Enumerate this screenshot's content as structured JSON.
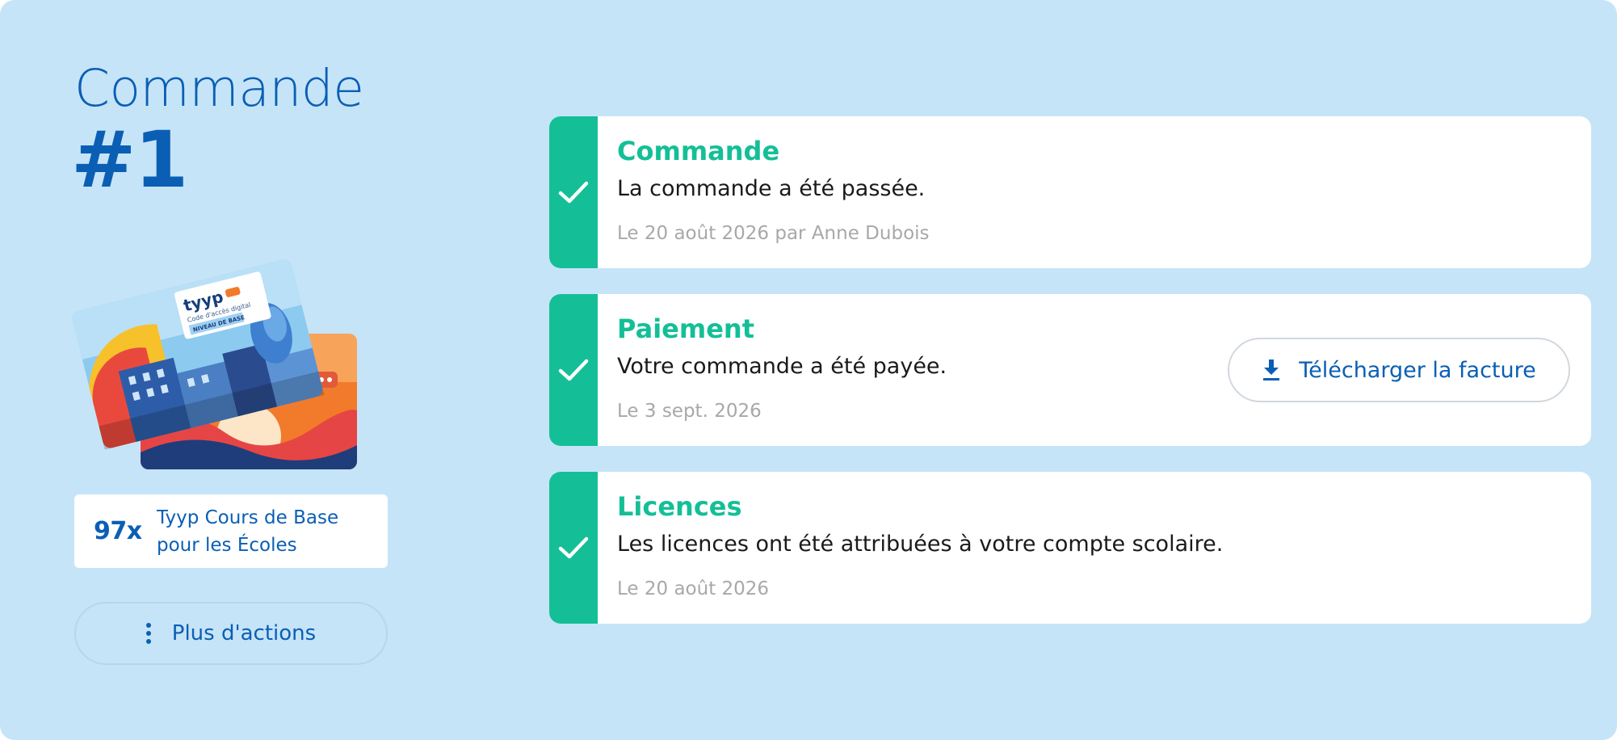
{
  "order": {
    "label": "Commande",
    "number": "#1"
  },
  "product": {
    "quantity": "97x",
    "name": "Tyyp Cours de Base pour les Écoles",
    "card_brand": "tyyp",
    "card_subtitle": "Code d'accès digital",
    "card_badge": "NIVEAU DE BASE"
  },
  "actions": {
    "more_label": "Plus d'actions"
  },
  "steps": [
    {
      "title": "Commande",
      "description": "La commande a été passée.",
      "date": "Le 20 août 2026 par Anne Dubois",
      "status": "done"
    },
    {
      "title": "Paiement",
      "description": "Votre commande a été payée.",
      "date": "Le 3 sept. 2026",
      "status": "done",
      "action_label": "Télécharger la facture"
    },
    {
      "title": "Licences",
      "description": "Les licences ont été attribuées à votre compte scolaire.",
      "date": "Le 20 août 2026",
      "status": "done"
    }
  ],
  "colors": {
    "background": "#c6e4f8",
    "primary": "#0a5fb4",
    "success": "#14bf97",
    "muted": "#a8a8a8"
  },
  "icons": {
    "step_status": "check-icon",
    "invoice": "download-icon",
    "more": "vertical-dots-icon"
  }
}
